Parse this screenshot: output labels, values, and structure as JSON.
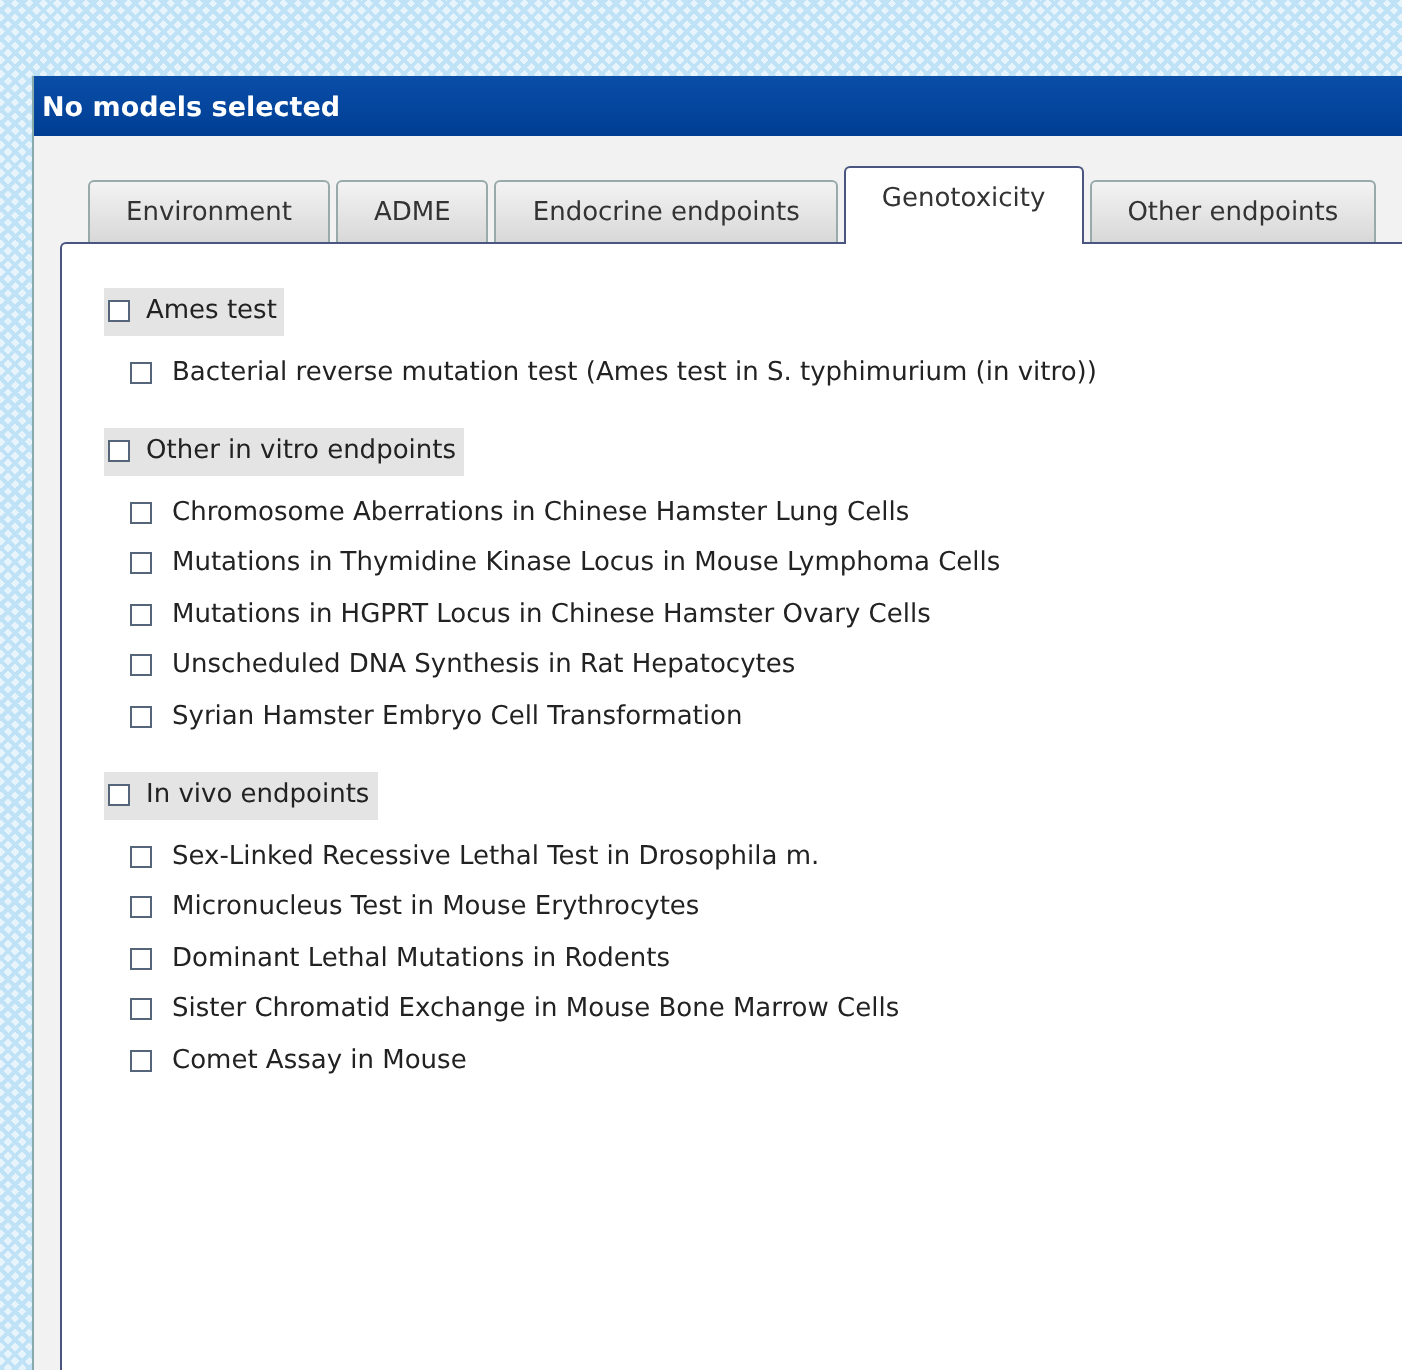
{
  "window": {
    "title": "No models selected"
  },
  "tabs": [
    {
      "label": "Environment",
      "selected": false
    },
    {
      "label": "ADME",
      "selected": false
    },
    {
      "label": "Endocrine endpoints",
      "selected": false
    },
    {
      "label": "Genotoxicity",
      "selected": true
    },
    {
      "label": "Other endpoints",
      "selected": false
    }
  ],
  "groups": [
    {
      "label": "Ames test",
      "checked": false,
      "children": [
        {
          "label": "Bacterial reverse mutation test (Ames test in S. typhimurium (in vitro))",
          "checked": false
        }
      ]
    },
    {
      "label": "Other in vitro endpoints",
      "checked": false,
      "children": [
        {
          "label": "Chromosome Aberrations in Chinese Hamster Lung Cells",
          "checked": false
        },
        {
          "label": "Mutations in Thymidine Kinase Locus in Mouse Lymphoma Cells",
          "checked": false
        },
        {
          "label": "Mutations in HGPRT Locus in Chinese Hamster Ovary Cells",
          "checked": false
        },
        {
          "label": "Unscheduled DNA Synthesis in Rat Hepatocytes",
          "checked": false
        },
        {
          "label": "Syrian Hamster Embryo Cell Transformation",
          "checked": false
        }
      ]
    },
    {
      "label": "In vivo endpoints",
      "checked": false,
      "children": [
        {
          "label": "Sex-Linked Recessive Lethal Test in Drosophila m.",
          "checked": false
        },
        {
          "label": "Micronucleus Test in Mouse Erythrocytes",
          "checked": false
        },
        {
          "label": "Dominant Lethal Mutations in Rodents",
          "checked": false
        },
        {
          "label": "Sister Chromatid Exchange in Mouse Bone Marrow Cells",
          "checked": false
        },
        {
          "label": "Comet Assay in Mouse",
          "checked": false
        }
      ]
    }
  ]
}
